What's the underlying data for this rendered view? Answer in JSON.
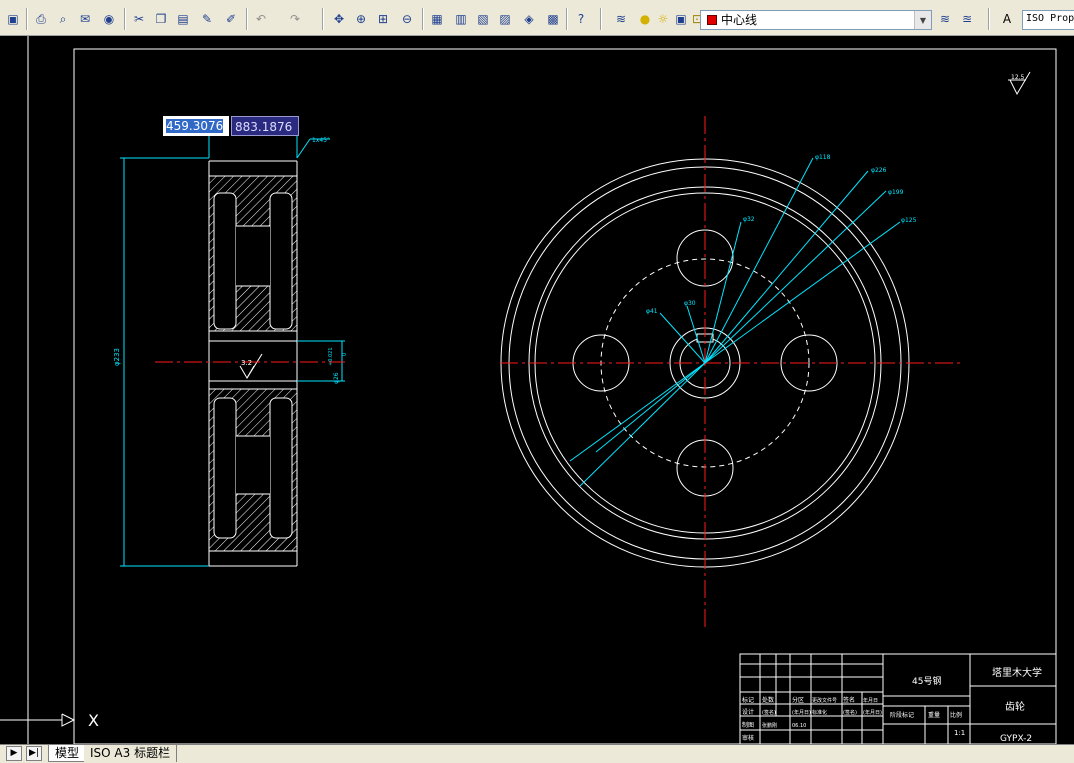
{
  "toolbar": {
    "layer": {
      "name": "中心线",
      "color": "#e00000"
    },
    "text_style": "ISO Prop"
  },
  "dynamic_input": {
    "x_value": "459.3076",
    "y_value": "883.1876"
  },
  "drawing": {
    "colors": {
      "background": "#000000",
      "object": "#ffffff",
      "dimension": "#00e5ff",
      "center": "#ff1a1a",
      "hatch": "#ffffff"
    },
    "roughness": "12.5",
    "chamfer": "1x45°",
    "left_dims": {
      "outer_dia": "φ233",
      "bore": "φ26",
      "bore_tol_upper": "+0.021",
      "bore_tol_lower": "0",
      "groove": "3.2"
    },
    "right_dims": {
      "d1": "φ118",
      "d2": "φ226",
      "d3": "φ199",
      "d4": "φ125",
      "d5": "φ32",
      "d6": "φ30",
      "d7": "φ41"
    }
  },
  "title_block": {
    "material": "45号钢",
    "school": "塔里木大学",
    "part_name": "齿轮",
    "drawing_no": "GYPX-2",
    "scale": "1:1",
    "rows": [
      {
        "label": "标记",
        "c1": "处数",
        "c2": "分区",
        "c3": "更改文件号",
        "c4": "签名",
        "c5": "年月日"
      },
      {
        "label": "设计",
        "c1": "(签名)",
        "c2": "(年月日)",
        "c3": "标准化",
        "c4": "(签名)",
        "c5": "(年月日)"
      },
      {
        "label": "制图",
        "c1": "张鹏刚",
        "c2": "06.10",
        "c3": "",
        "c4": "",
        "c5": ""
      },
      {
        "label": "审核",
        "c1": "",
        "c2": "",
        "c3": "",
        "c4": "",
        "c5": ""
      }
    ],
    "headers": {
      "stage": "阶段标记",
      "weight": "重量",
      "ratio": "比例"
    }
  },
  "tabs": {
    "model": "模型",
    "layout": "ISO A3 标题栏"
  },
  "ucs": {
    "x_label": "X"
  }
}
